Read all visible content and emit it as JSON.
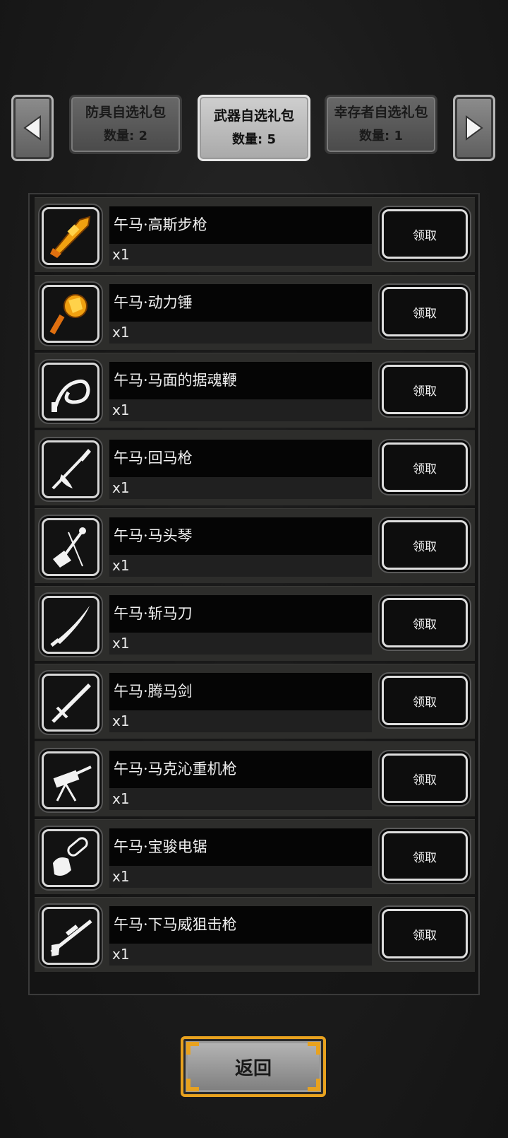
{
  "tabs": [
    {
      "label": "防具自选礼包",
      "count": "数量: 2",
      "active": false
    },
    {
      "label": "武器自选礼包",
      "count": "数量: 5",
      "active": true
    },
    {
      "label": "幸存者自选礼包",
      "count": "数量: 1",
      "active": false
    }
  ],
  "nav": {
    "prev_icon": "left-arrow-icon",
    "next_icon": "right-arrow-icon"
  },
  "items": [
    {
      "name": "午马·高斯步枪",
      "qty": "x1",
      "button": "领取",
      "icon": "gauss-rifle-icon",
      "color": "gold"
    },
    {
      "name": "午马·动力锤",
      "qty": "x1",
      "button": "领取",
      "icon": "power-hammer-icon",
      "color": "gold"
    },
    {
      "name": "午马·马面的据魂鞭",
      "qty": "x1",
      "button": "领取",
      "icon": "soul-whip-icon",
      "color": "white"
    },
    {
      "name": "午马·回马枪",
      "qty": "x1",
      "button": "领取",
      "icon": "spear-icon",
      "color": "white"
    },
    {
      "name": "午马·马头琴",
      "qty": "x1",
      "button": "领取",
      "icon": "horsehead-fiddle-icon",
      "color": "white"
    },
    {
      "name": "午马·斩马刀",
      "qty": "x1",
      "button": "领取",
      "icon": "saber-icon",
      "color": "white"
    },
    {
      "name": "午马·腾马剑",
      "qty": "x1",
      "button": "领取",
      "icon": "sword-icon",
      "color": "white"
    },
    {
      "name": "午马·马克沁重机枪",
      "qty": "x1",
      "button": "领取",
      "icon": "heavy-machine-gun-icon",
      "color": "white"
    },
    {
      "name": "午马·宝骏电锯",
      "qty": "x1",
      "button": "领取",
      "icon": "chainsaw-icon",
      "color": "white"
    },
    {
      "name": "午马·下马威狙击枪",
      "qty": "x1",
      "button": "领取",
      "icon": "sniper-rifle-icon",
      "color": "white"
    }
  ],
  "footer": {
    "back_label": "返回"
  },
  "colors": {
    "gold": "#f0a010",
    "white": "#f2f2f2",
    "accent": "#e8a21f"
  }
}
